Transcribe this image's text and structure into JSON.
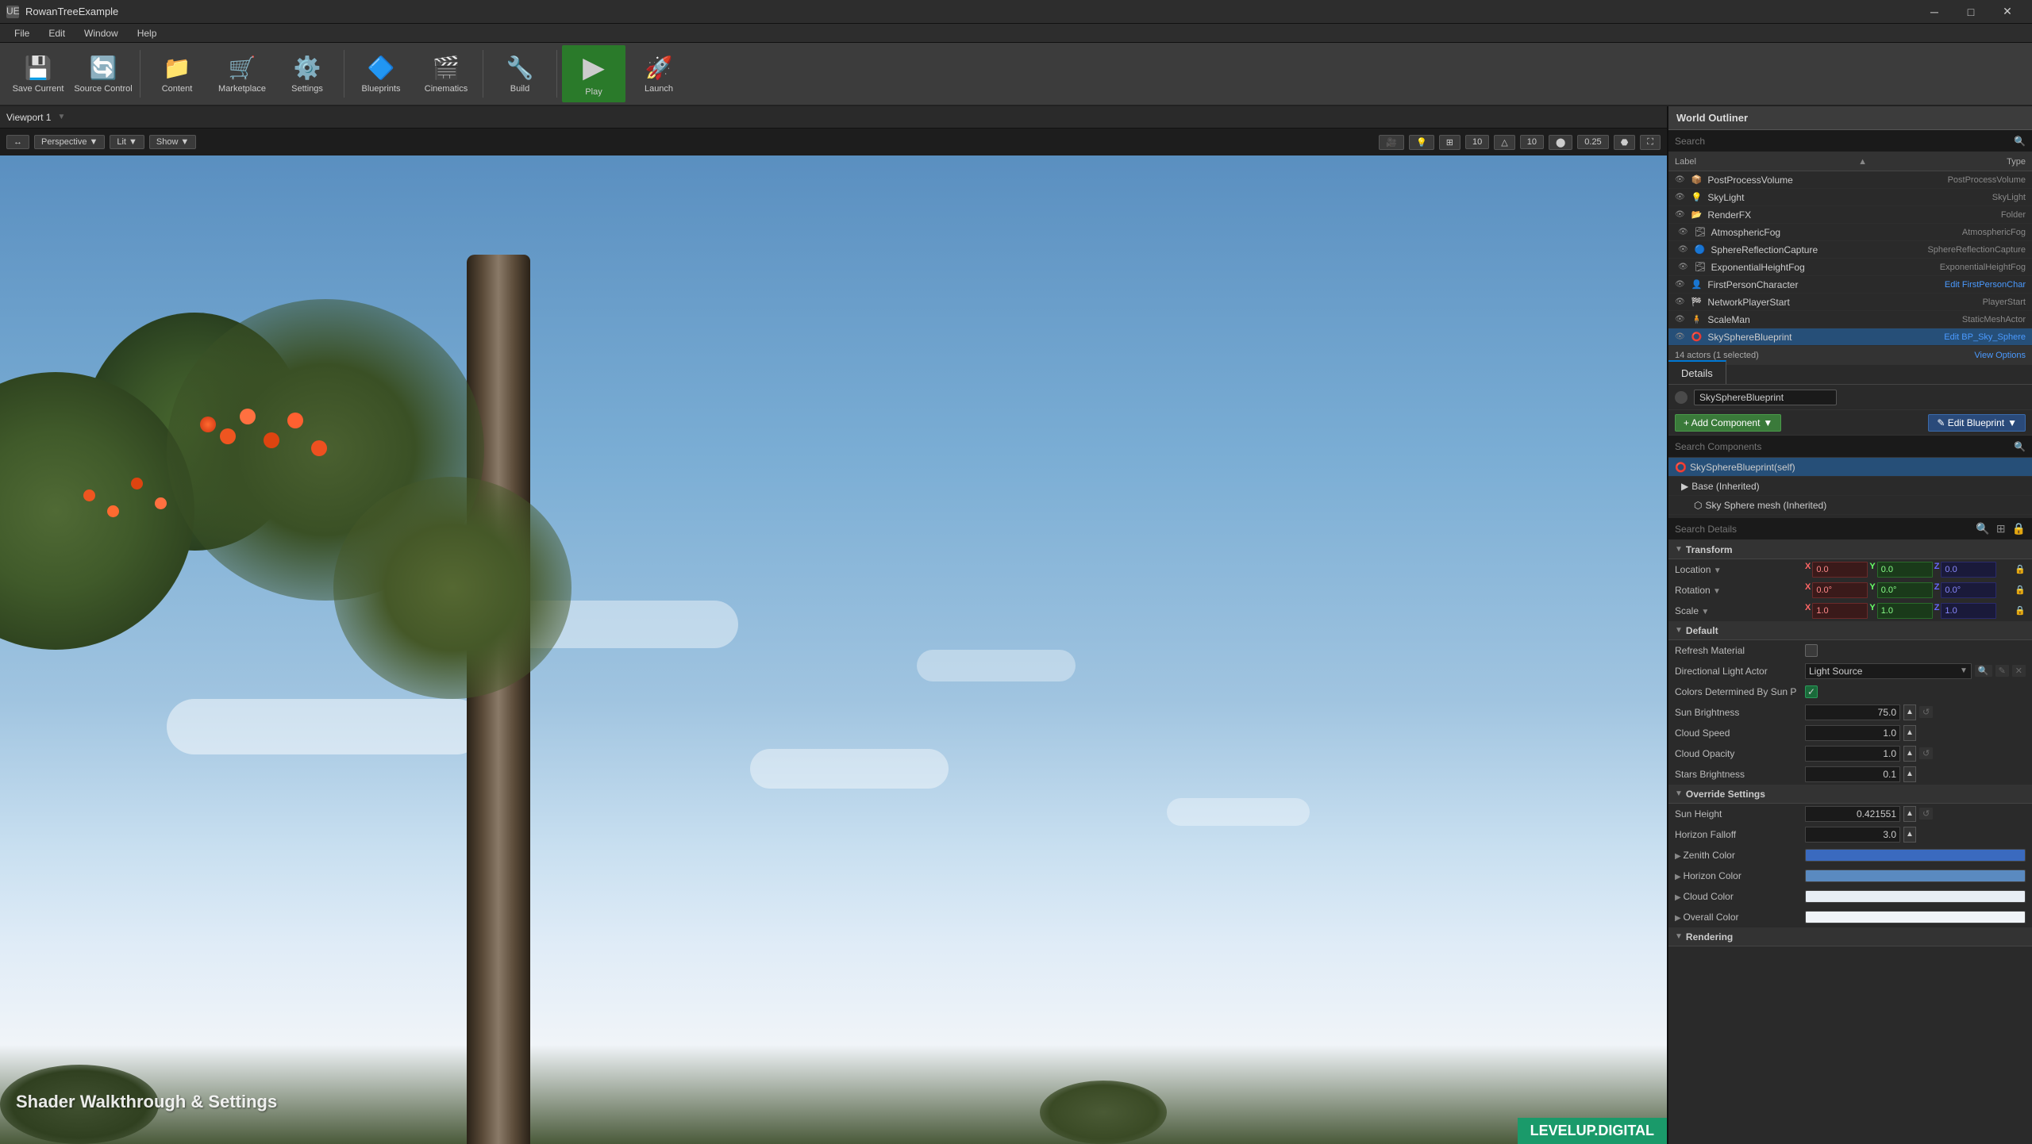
{
  "app": {
    "title": "RowanTreeExample",
    "icon": "ue4-icon"
  },
  "window_controls": {
    "minimize": "─",
    "maximize": "□",
    "close": "✕"
  },
  "menu": {
    "items": [
      "File",
      "Edit",
      "Window",
      "Help"
    ]
  },
  "toolbar": {
    "buttons": [
      {
        "id": "save-current",
        "label": "Save Current",
        "icon": "💾"
      },
      {
        "id": "source-control",
        "label": "Source Control",
        "icon": "🔄"
      },
      {
        "id": "content",
        "label": "Content",
        "icon": "📁"
      },
      {
        "id": "marketplace",
        "label": "Marketplace",
        "icon": "🛒"
      },
      {
        "id": "settings",
        "label": "Settings",
        "icon": "⚙️"
      },
      {
        "id": "blueprints",
        "label": "Blueprints",
        "icon": "🔷"
      },
      {
        "id": "cinematics",
        "label": "Cinematics",
        "icon": "🎬"
      },
      {
        "id": "build",
        "label": "Build",
        "icon": "🔧"
      },
      {
        "id": "play",
        "label": "Play",
        "icon": "▶"
      },
      {
        "id": "launch",
        "label": "Launch",
        "icon": "🚀"
      }
    ]
  },
  "viewport": {
    "tab_label": "Viewport 1",
    "view_mode": "Perspective",
    "lighting": "Lit",
    "show_btn": "Show",
    "numbers": [
      "10",
      "10",
      "0.25"
    ],
    "watermark": "Shader Walkthrough & Settings",
    "levelup": "LEVELUP.DIGITAL"
  },
  "world_outliner": {
    "title": "World Outliner",
    "search_placeholder": "Search",
    "col_label": "Label",
    "col_type": "Type",
    "actors": [
      {
        "name": "PostProcessVolume",
        "type": "PostProcessVolume",
        "indent": 0
      },
      {
        "name": "SkyLight",
        "type": "SkyLight",
        "indent": 0
      },
      {
        "name": "RenderFX",
        "type": "Folder",
        "indent": 0
      },
      {
        "name": "AtmosphericFog",
        "type": "AtmosphericFog",
        "indent": 1
      },
      {
        "name": "SphereReflectionCapture",
        "type": "SphereReflectionCapture",
        "indent": 1
      },
      {
        "name": "ExponentialHeightFog",
        "type": "ExponentialHeightFog",
        "indent": 1
      },
      {
        "name": "FirstPersonCharacter",
        "type": "Edit FirstPersonChar",
        "indent": 0
      },
      {
        "name": "NetworkPlayerStart",
        "type": "PlayerStart",
        "indent": 0
      },
      {
        "name": "ScaleMan",
        "type": "StaticMeshActor",
        "indent": 0
      },
      {
        "name": "SkySphereBlueprint",
        "type": "Edit BP_Sky_Sphere",
        "indent": 0,
        "selected": true
      }
    ],
    "footer": "14 actors (1 selected)",
    "view_options": "View Options"
  },
  "details": {
    "tab_label": "Details",
    "blueprint_name": "SkySphereBlueprint",
    "add_component_label": "+ Add Component",
    "edit_blueprint_label": "✎ Edit Blueprint",
    "search_components_placeholder": "Search Components",
    "components": [
      {
        "name": "SkySphereBlueprint(self)",
        "indent": 0,
        "selected": true
      },
      {
        "name": "Base (Inherited)",
        "indent": 1
      },
      {
        "name": "Sky Sphere mesh (Inherited)",
        "indent": 2
      }
    ],
    "search_details_placeholder": "Search Details",
    "transform": {
      "label": "Transform",
      "location": {
        "label": "Location",
        "x": "0.0",
        "y": "0.0",
        "z": "0.0"
      },
      "rotation": {
        "label": "Rotation",
        "x": "0.0°",
        "y": "0.0°",
        "z": "0.0°"
      },
      "scale": {
        "label": "Scale",
        "x": "1.0",
        "y": "1.0",
        "z": "1.0"
      }
    },
    "default_section": {
      "label": "Default",
      "refresh_material": {
        "label": "Refresh Material",
        "value": false
      },
      "directional_light_actor": {
        "label": "Directional Light Actor",
        "value": "Light Source"
      },
      "colors_by_sun": {
        "label": "Colors Determined By Sun P",
        "value": true
      },
      "sun_brightness": {
        "label": "Sun Brightness",
        "value": "75.0"
      },
      "cloud_speed": {
        "label": "Cloud Speed",
        "value": "1.0"
      },
      "cloud_opacity": {
        "label": "Cloud Opacity",
        "value": "1.0"
      },
      "stars_brightness": {
        "label": "Stars Brightness",
        "value": "0.1"
      }
    },
    "override_section": {
      "label": "Override Settings",
      "sun_height": {
        "label": "Sun Height",
        "value": "0.421551"
      },
      "horizon_falloff": {
        "label": "Horizon Falloff",
        "value": "3.0"
      },
      "zenith_color": {
        "label": "Zenith Color",
        "color": "#3a6abf"
      },
      "horizon_color": {
        "label": "Horizon Color",
        "color": "#5a8ac0"
      },
      "cloud_color": {
        "label": "Cloud Color",
        "color": "#e8eef5"
      },
      "overall_color": {
        "label": "Overall Color",
        "color": "#f0f4f8"
      }
    },
    "rendering_section": {
      "label": "Rendering"
    }
  }
}
